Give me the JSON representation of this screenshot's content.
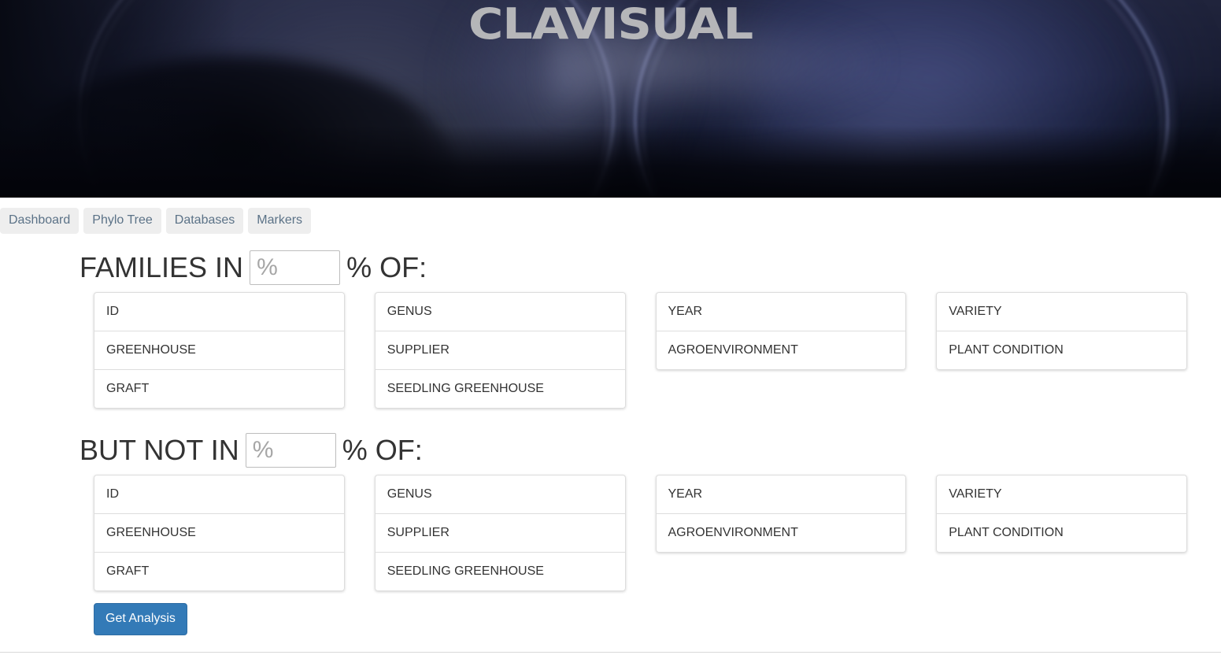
{
  "banner": {
    "title": "CLAVISUAL",
    "image_name": "petri-dish-banner"
  },
  "nav": {
    "items": [
      {
        "label": "Dashboard",
        "name": "nav-tab-dashboard"
      },
      {
        "label": "Phylo Tree",
        "name": "nav-tab-phylo-tree"
      },
      {
        "label": "Databases",
        "name": "nav-tab-databases"
      },
      {
        "label": "Markers",
        "name": "nav-tab-markers"
      }
    ]
  },
  "include_section": {
    "heading_prefix": "FAMILIES IN",
    "heading_suffix": "% OF:",
    "percent_value": "",
    "percent_placeholder": "%",
    "columns": [
      {
        "items": [
          "ID",
          "GREENHOUSE",
          "GRAFT"
        ]
      },
      {
        "items": [
          "GENUS",
          "SUPPLIER",
          "SEEDLING GREENHOUSE"
        ]
      },
      {
        "items": [
          "YEAR",
          "AGROENVIRONMENT"
        ]
      },
      {
        "items": [
          "VARIETY",
          "PLANT CONDITION"
        ]
      }
    ]
  },
  "exclude_section": {
    "heading_prefix": "BUT NOT IN",
    "heading_suffix": "% OF:",
    "percent_value": "",
    "percent_placeholder": "%",
    "columns": [
      {
        "items": [
          "ID",
          "GREENHOUSE",
          "GRAFT"
        ]
      },
      {
        "items": [
          "GENUS",
          "SUPPLIER",
          "SEEDLING GREENHOUSE"
        ]
      },
      {
        "items": [
          "YEAR",
          "AGROENVIRONMENT"
        ]
      },
      {
        "items": [
          "VARIETY",
          "PLANT CONDITION"
        ]
      }
    ]
  },
  "actions": {
    "submit_label": "Get Analysis"
  },
  "colors": {
    "primary_button": "#337ab7",
    "primary_button_border": "#2e6da4",
    "nav_button_bg": "#eeeeee",
    "nav_button_text": "#5b7287",
    "text": "#333333",
    "list_border": "#dddddd",
    "banner_title": "#c4c4c4"
  }
}
